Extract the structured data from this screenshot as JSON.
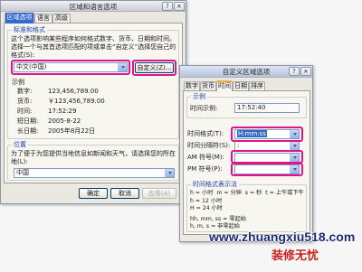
{
  "main_dialog": {
    "title": "区域和语言选项",
    "help_label": "?",
    "tabs": [
      {
        "label": "区域选项",
        "selected": true
      },
      {
        "label": "语言",
        "selected": false
      },
      {
        "label": "高级",
        "selected": false
      }
    ],
    "standards": {
      "group_label": "标准和格式",
      "description": "这个选项影响某些程序如何格式数字、货币、日期和时间。",
      "instruction": "选择一个与其首选项匹配的项或单击“自定义”选择您自己的格式(S):",
      "locale_value": "中文(中国)",
      "customize_button": "自定义(Z)..."
    },
    "samples": {
      "label": "示例",
      "rows": [
        {
          "label": "数字:",
          "value": "123,456,789.00"
        },
        {
          "label": "货币:",
          "value": "￥123,456,789.00"
        },
        {
          "label": "时间:",
          "value": "17:52:29"
        },
        {
          "label": "短日期:",
          "value": "2005-8-22"
        },
        {
          "label": "长日期:",
          "value": "2005年8月22日"
        }
      ]
    },
    "location": {
      "group_label": "位置",
      "description": "为了便于为您提供当地信息如新闻和天气，请选择您的所在地(L):",
      "value": "中国"
    },
    "buttons": {
      "ok": "确定",
      "cancel": "取消",
      "apply": "应用(A)"
    }
  },
  "custom_dialog": {
    "title": "自定义区域选项",
    "help_label": "?",
    "tabs": [
      {
        "label": "数字",
        "selected": false
      },
      {
        "label": "货币",
        "selected": false
      },
      {
        "label": "时间",
        "selected": true
      },
      {
        "label": "日期",
        "selected": false
      },
      {
        "label": "排序",
        "selected": false
      }
    ],
    "sample": {
      "group_label": "示例",
      "label": "时间示例:",
      "value": "17:52:40"
    },
    "fields": [
      {
        "label": "时间格式(T):",
        "value": "H:mm:ss"
      },
      {
        "label": "时间分隔符(S):",
        "value": ":"
      },
      {
        "label": "AM 符号(M):",
        "value": ""
      },
      {
        "label": "PM 符号(P):",
        "value": ""
      }
    ],
    "notation": {
      "group_label": "时间格式表示法",
      "lines": [
        "h = 小时  m = 分钟  s = 秒  t = 上午或下午",
        "h = 12 小时",
        "H = 24 小时",
        "hh, mm, ss = 零起始",
        "h, m, s = 非零起始"
      ]
    }
  },
  "watermark": {
    "url": "www.zhuangxiu518.com",
    "brand": "装修无忧"
  },
  "colors": {
    "highlight": "#e0148c",
    "selection": "#3468cf",
    "watermark_url": "#1c2a78",
    "watermark_brand": "#c8201e"
  }
}
